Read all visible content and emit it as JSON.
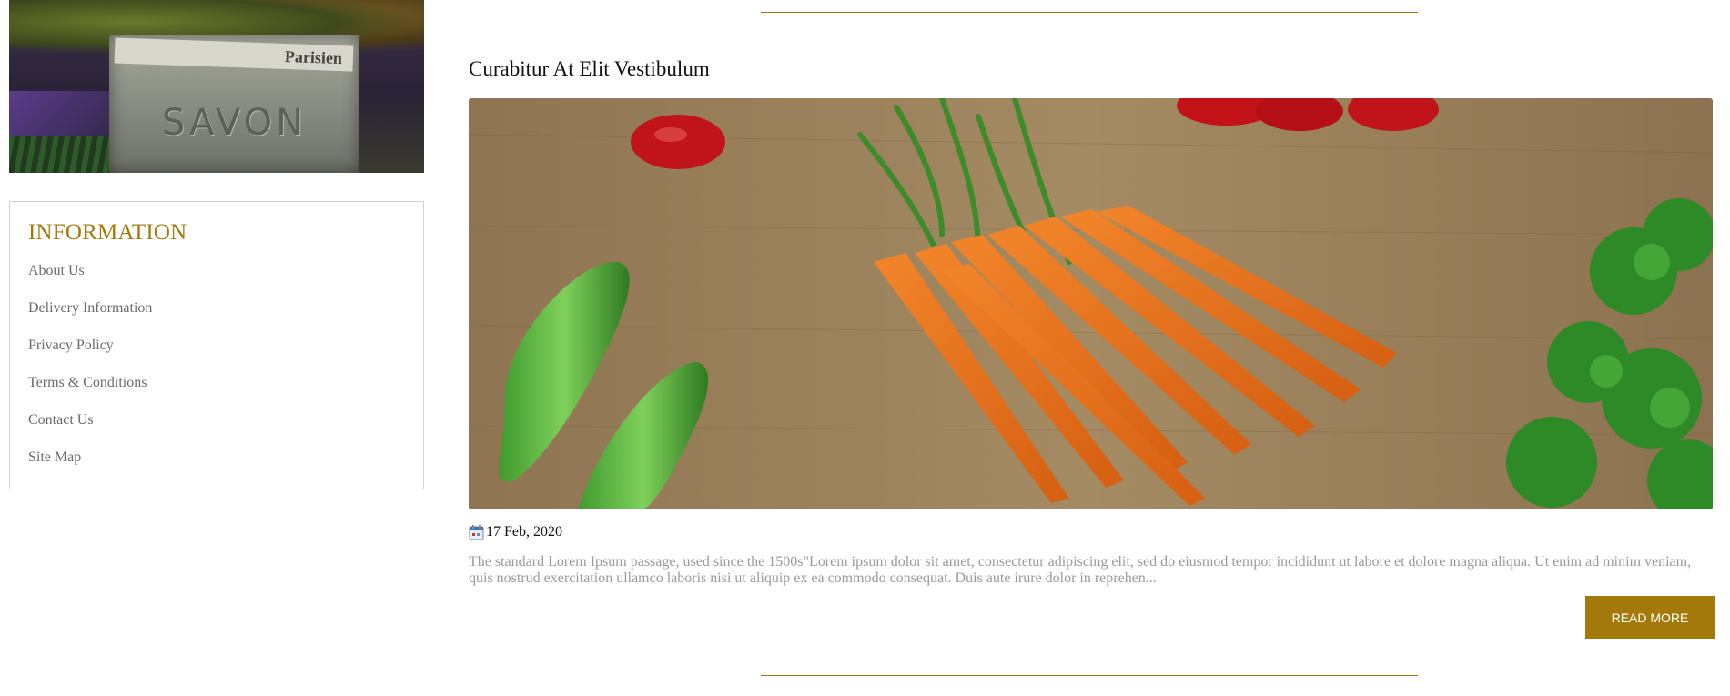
{
  "sidebar": {
    "banner": {
      "image_alt": "Vegetables in a tin box",
      "paper_text": "Parisien",
      "tin_text": "SAVON"
    },
    "information": {
      "title": "INFORMATION",
      "links": [
        {
          "label": "About Us"
        },
        {
          "label": "Delivery Information"
        },
        {
          "label": "Privacy Policy"
        },
        {
          "label": "Terms & Conditions"
        },
        {
          "label": "Contact Us"
        },
        {
          "label": "Site Map"
        }
      ]
    }
  },
  "post": {
    "title": "Curabitur At Elit Vestibulum",
    "image_alt": "Carrots, zucchini and tomatoes on a wooden table",
    "date": "17 Feb, 2020",
    "excerpt": "The standard Lorem Ipsum passage, used since the 1500s\"Lorem ipsum dolor sit amet, consectetur adipiscing elit, sed do eiusmod tempor incididunt ut labore et dolore magna aliqua. Ut enim ad minim veniam, quis nostrud exercitation ullamco laboris nisi ut aliquip ex ea commodo consequat. Duis aute irure dolor in reprehen...",
    "read_more_label": "READ MORE"
  },
  "colors": {
    "accent": "#a37a0a",
    "link": "#6b6b6b",
    "excerpt": "#9a9a9a",
    "border": "#d3d3d3"
  },
  "icons": {
    "date": "calendar-icon"
  }
}
